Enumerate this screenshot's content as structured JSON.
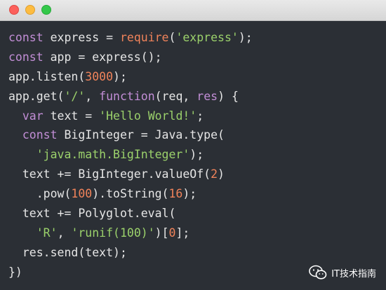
{
  "window": {
    "controls": [
      "close-icon",
      "minimize-icon",
      "maximize-icon"
    ]
  },
  "code": {
    "lines": [
      [
        {
          "t": "kw",
          "v": "const"
        },
        {
          "t": "txt",
          "v": " express = "
        },
        {
          "t": "fn",
          "v": "require"
        },
        {
          "t": "txt",
          "v": "("
        },
        {
          "t": "str",
          "v": "'express'"
        },
        {
          "t": "txt",
          "v": ");"
        }
      ],
      [
        {
          "t": "kw",
          "v": "const"
        },
        {
          "t": "txt",
          "v": " app = express();"
        }
      ],
      [
        {
          "t": "txt",
          "v": "app.listen("
        },
        {
          "t": "num",
          "v": "3000"
        },
        {
          "t": "txt",
          "v": ");"
        }
      ],
      [
        {
          "t": "txt",
          "v": "app.get("
        },
        {
          "t": "str",
          "v": "'/'"
        },
        {
          "t": "txt",
          "v": ", "
        },
        {
          "t": "kw",
          "v": "function"
        },
        {
          "t": "txt",
          "v": "(req, "
        },
        {
          "t": "kw",
          "v": "res"
        },
        {
          "t": "txt",
          "v": ") {"
        }
      ],
      [
        {
          "t": "txt",
          "v": "  "
        },
        {
          "t": "kw",
          "v": "var"
        },
        {
          "t": "txt",
          "v": " text = "
        },
        {
          "t": "str",
          "v": "'Hello World!'"
        },
        {
          "t": "txt",
          "v": ";"
        }
      ],
      [
        {
          "t": "txt",
          "v": "  "
        },
        {
          "t": "kw",
          "v": "const"
        },
        {
          "t": "txt",
          "v": " BigInteger = Java.type("
        }
      ],
      [
        {
          "t": "txt",
          "v": "    "
        },
        {
          "t": "str",
          "v": "'java.math.BigInteger'"
        },
        {
          "t": "txt",
          "v": ");"
        }
      ],
      [
        {
          "t": "txt",
          "v": "  text += BigInteger.valueOf("
        },
        {
          "t": "num",
          "v": "2"
        },
        {
          "t": "txt",
          "v": ")"
        }
      ],
      [
        {
          "t": "txt",
          "v": "    .pow("
        },
        {
          "t": "num",
          "v": "100"
        },
        {
          "t": "txt",
          "v": ").toString("
        },
        {
          "t": "num",
          "v": "16"
        },
        {
          "t": "txt",
          "v": ");"
        }
      ],
      [
        {
          "t": "txt",
          "v": "  text += Polyglot.eval("
        }
      ],
      [
        {
          "t": "txt",
          "v": "    "
        },
        {
          "t": "str",
          "v": "'R'"
        },
        {
          "t": "txt",
          "v": ", "
        },
        {
          "t": "str",
          "v": "'runif(100)'"
        },
        {
          "t": "txt",
          "v": ")["
        },
        {
          "t": "num",
          "v": "0"
        },
        {
          "t": "txt",
          "v": "];"
        }
      ],
      [
        {
          "t": "txt",
          "v": "  res.send(text);"
        }
      ],
      [
        {
          "t": "txt",
          "v": "})"
        }
      ]
    ]
  },
  "watermark": {
    "icon": "wechat-icon",
    "text": "IT技术指南"
  },
  "colors": {
    "background": "#2b2f35",
    "keyword": "#c28ed6",
    "function": "#f0835a",
    "string": "#9bd16b",
    "number": "#f0835a",
    "text": "#e6e6e6"
  }
}
